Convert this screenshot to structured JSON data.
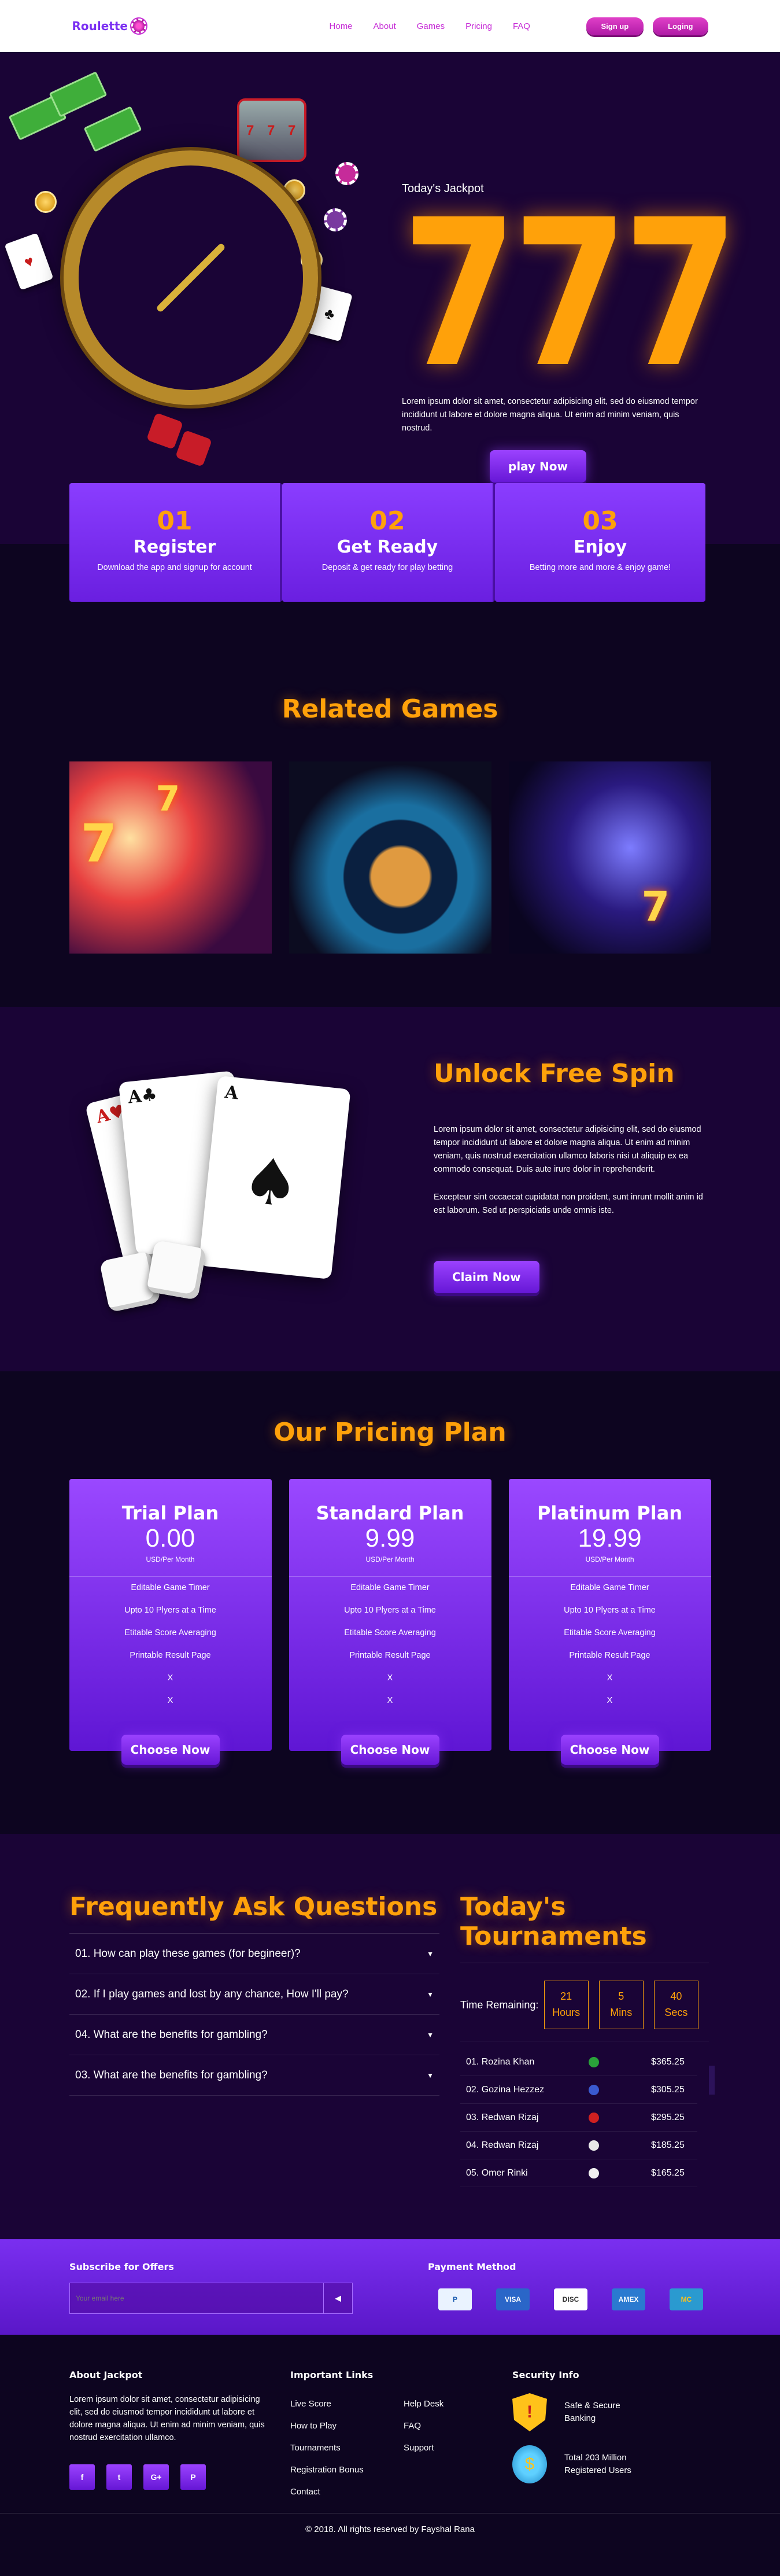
{
  "nav": {
    "logo": "Roulette",
    "links": [
      "Home",
      "About",
      "Games",
      "Pricing",
      "FAQ"
    ],
    "signup": "Sign up",
    "login": "Loging"
  },
  "hero": {
    "label": "Today's Jackpot",
    "jackpot": "777",
    "text": "Lorem ipsum dolor sit amet, consectetur adipisicing elit, sed do eiusmod tempor incididunt ut labore et dolore magna aliqua. Ut enim ad minim veniam, quis nostrud.",
    "cta": "play Now"
  },
  "steps": [
    {
      "num": "01",
      "title": "Register",
      "desc": "Download the app and signup for account"
    },
    {
      "num": "02",
      "title": "Get Ready",
      "desc": "Deposit & get ready for play betting"
    },
    {
      "num": "03",
      "title": "Enjoy",
      "desc": "Betting more and more & enjoy game!"
    }
  ],
  "related": {
    "title": "Related Games"
  },
  "spin": {
    "title": "Unlock Free Spin",
    "p1": "Lorem ipsum dolor sit amet, consectetur adipisicing elit, sed do eiusmod tempor incididunt ut labore et dolore magna aliqua. Ut enim ad minim veniam, quis nostrud exercitation ullamco laboris nisi ut aliquip ex ea commodo consequat. Duis aute irure dolor in reprehenderit.",
    "p2": "Excepteur sint occaecat cupidatat non proident, sunt inrunt mollit anim id est laborum. Sed ut perspiciatis unde omnis iste.",
    "cta": "Claim Now"
  },
  "pricing": {
    "title": "Our Pricing Plan",
    "plans": [
      {
        "name": "Trial Plan",
        "price": "0.00",
        "per": "USD/Per Month"
      },
      {
        "name": "Standard Plan",
        "price": "9.99",
        "per": "USD/Per Month"
      },
      {
        "name": "Platinum Plan",
        "price": "19.99",
        "per": "USD/Per Month"
      }
    ],
    "features": [
      "Editable Game Timer",
      "Upto 10 Plyers at a Time",
      "Etitable Score Averaging",
      "Printable Result Page",
      "X",
      "X"
    ],
    "cta": "Choose Now"
  },
  "faq": {
    "title": "Frequently Ask Questions",
    "items": [
      "01. How can play these games (for begineer)?",
      "02. If I play games and lost by any chance, How I'll pay?",
      "04. What are the benefits for gambling?",
      "03. What are the benefits for gambling?"
    ]
  },
  "tournaments": {
    "title": "Today's Tournaments",
    "label": "Time Remaining:",
    "timer": [
      {
        "v": "21",
        "u": "Hours"
      },
      {
        "v": "5",
        "u": "Mins"
      },
      {
        "v": "40",
        "u": "Secs"
      }
    ],
    "rows": [
      {
        "name": "01. Rozina Khan",
        "amt": "$365.25",
        "flag": "#2aa33a"
      },
      {
        "name": "02. Gozina Hezzez",
        "amt": "$305.25",
        "flag": "#3a5ad0"
      },
      {
        "name": "03. Redwan Rizaj",
        "amt": "$295.25",
        "flag": "#d02020"
      },
      {
        "name": "04. Redwan Rizaj",
        "amt": "$185.25",
        "flag": "#e8e8e8"
      },
      {
        "name": "05. Omer Rinki",
        "amt": "$165.25",
        "flag": "#f0f0f0"
      }
    ]
  },
  "subscribe": {
    "title": "Subscribe for Offers",
    "placeholder": "Your email here",
    "payment": "Payment Method",
    "cards": [
      "P",
      "VISA",
      "DISC",
      "AMEX",
      "MC"
    ]
  },
  "footer": {
    "about_title": "About Jackpot",
    "about": "Lorem ipsum dolor sit amet, consectetur adipisicing elit, sed do eiusmod tempor incididunt ut labore et dolore magna aliqua. Ut enim ad minim veniam, quis nostrud exercitation ullamco.",
    "socials": [
      "f",
      "t",
      "G+",
      "P"
    ],
    "links_title": "Important Links",
    "links1": [
      "Live Score",
      "How to Play",
      "Tournaments",
      "Registration Bonus",
      "Contact"
    ],
    "links2": [
      "Help Desk",
      "FAQ",
      "Support"
    ],
    "security_title": "Security Info",
    "security": [
      "Safe & Secure Banking",
      "Total 203 Million Registered Users"
    ],
    "copyright": "© 2018. All rights reserved by Fayshal Rana"
  }
}
